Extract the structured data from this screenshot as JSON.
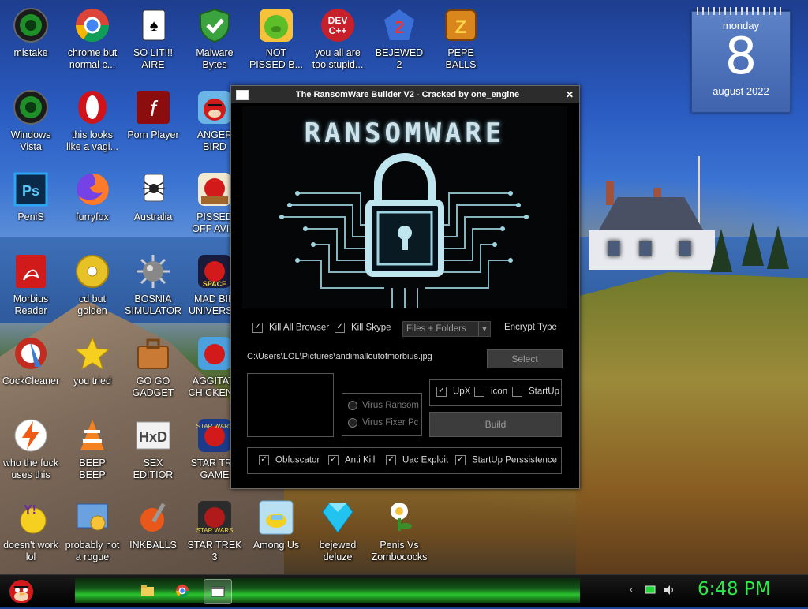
{
  "desktop": {
    "icons": [
      {
        "label": "mistake",
        "icon": "xbox-orb-icon"
      },
      {
        "label": "chrome but\nnormal c...",
        "icon": "chrome-icon"
      },
      {
        "label": "SO LIT!!!\nAIRE",
        "icon": "solitaire-icon"
      },
      {
        "label": "Malware\nBytes",
        "icon": "shield-check-icon"
      },
      {
        "label": "NOT\nPISSED B...",
        "icon": "green-pig-icon"
      },
      {
        "label": "you all are\ntoo stupid...",
        "icon": "devcpp-icon"
      },
      {
        "label": "BEJEWED\n2",
        "icon": "bejeweled-icon"
      },
      {
        "label": "PEPE\nBALLS",
        "icon": "zuma-icon"
      },
      {
        "label": "Windows\nVista",
        "icon": "xbox-orb-icon"
      },
      {
        "label": "this looks\nlike a vagi...",
        "icon": "opera-icon"
      },
      {
        "label": "Porn Player",
        "icon": "flash-icon"
      },
      {
        "label": "ANGER\nBIRD",
        "icon": "angry-bird-icon"
      },
      {
        "label": "PeniS",
        "icon": "photoshop-icon"
      },
      {
        "label": "furryfox",
        "icon": "firefox-icon"
      },
      {
        "label": "Australia",
        "icon": "spider-solitaire-icon"
      },
      {
        "label": "PISSED\nOFF AVI...",
        "icon": "angry-birds-seasons-icon"
      },
      {
        "label": "Morbius\nReader",
        "icon": "acrobat-icon"
      },
      {
        "label": "cd but\ngolden",
        "icon": "golden-cd-icon"
      },
      {
        "label": "BOSNIA\nSIMULATOR",
        "icon": "mine-icon"
      },
      {
        "label": "MAD BIR\nUNIVERS...",
        "icon": "angry-birds-space-icon"
      },
      {
        "label": "CockCleaner",
        "icon": "ccleaner-icon"
      },
      {
        "label": "you tried",
        "icon": "star-icon"
      },
      {
        "label": "GO GO\nGADGET",
        "icon": "briefcase-icon"
      },
      {
        "label": "AGGITATI\nCHICKEN...",
        "icon": "angry-birds-rio-icon"
      },
      {
        "label": "who the fuck\nuses this",
        "icon": "winamp-bolt-icon"
      },
      {
        "label": "BEEP\nBEEP",
        "icon": "vlc-icon"
      },
      {
        "label": "SEX\nEDITIOR",
        "icon": "hxd-icon"
      },
      {
        "label": "STAR TRE\nGAME",
        "icon": "angry-birds-starwars-icon"
      },
      {
        "label": "doesn't work\nlol",
        "icon": "yahoo-messenger-icon"
      },
      {
        "label": "probably not\na rogue",
        "icon": "control-panel-icon"
      },
      {
        "label": "INKBALLS",
        "icon": "inkball-icon"
      },
      {
        "label": "STAR TREK\n3",
        "icon": "star-wars-icon"
      },
      {
        "label": "Among Us",
        "icon": "among-us-icon"
      },
      {
        "label": "bejewed\ndeluze",
        "icon": "diamond-icon"
      },
      {
        "label": "Penis Vs\nZombococks",
        "icon": "pvz-icon"
      }
    ]
  },
  "calendar": {
    "day": "monday",
    "date": "8",
    "month": "august 2022"
  },
  "window": {
    "title": "The RansomWare Builder V2 - Cracked by one_engine",
    "minimize": "–",
    "maximize": "□",
    "close": "✕",
    "banner_text": "RANSOMWARE",
    "kill_browser": "Kill All Browser",
    "kill_skype": "Kill Skype",
    "encrypt_select": "Files + Folders",
    "encrypt_type": "Encrypt Type",
    "path": "C:\\Users\\LOL\\Pictures\\andimalloutofmorbius.jpg",
    "select_button": "Select",
    "upx": "UpX",
    "icon": "icon",
    "startup": "StartUp",
    "virus_ransom": "Virus Ransom",
    "virus_fixer": "Virus Fixer Pc",
    "build_button": "Build",
    "obfuscator": "Obfuscator",
    "anti_kill": "Anti Kill",
    "uac_exploit": "Uac Exploit",
    "startup_persistence": "StartUp Perssistence"
  },
  "taskbar": {
    "clock": "6:48 PM"
  }
}
